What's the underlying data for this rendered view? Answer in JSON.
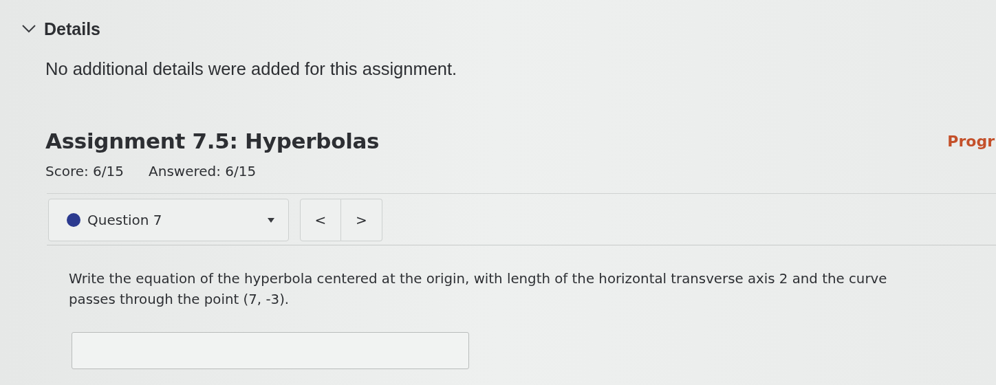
{
  "details": {
    "heading": "Details",
    "expanded": true,
    "text": "No additional details were added for this assignment."
  },
  "assignment": {
    "title": "Assignment 7.5: Hyperbolas",
    "progress_link": "Progr",
    "score": "Score: 6/15",
    "answered": "Answered: 6/15"
  },
  "question_nav": {
    "selected_question": "Question 7",
    "color": "#2b3a8f",
    "prev": "<",
    "next": ">"
  },
  "question": {
    "prompt": "Write the equation of the hyperbola centered at the origin, with length of the horizontal transverse axis 2 and the curve passes through the point (7, -3)."
  }
}
